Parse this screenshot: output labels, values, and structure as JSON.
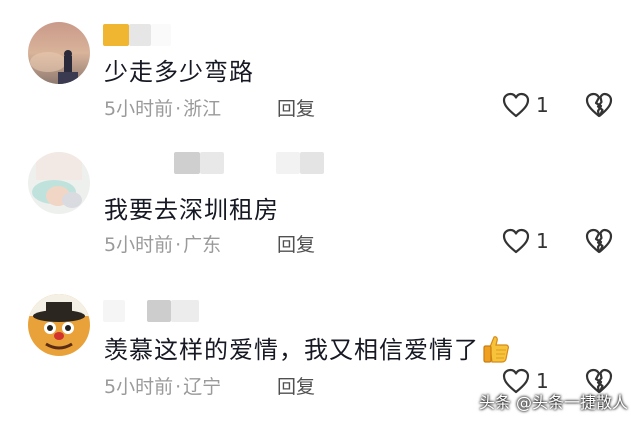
{
  "comments": [
    {
      "text": "少走多少弯路",
      "time": "5小时前",
      "location": "浙江",
      "reply_label": "回复",
      "likes": "1"
    },
    {
      "text": "我要去深圳租房",
      "time": "5小时前",
      "location": "广东",
      "reply_label": "回复",
      "likes": "1"
    },
    {
      "text": "羡慕这样的爱情，我又相信爱情了",
      "time": "5小时前",
      "location": "辽宁",
      "reply_label": "回复",
      "likes": "1"
    }
  ],
  "meta_separator": "·",
  "watermark": "头条 @头条一捷散人",
  "icons": {
    "like": "heart-outline-icon",
    "dislike": "broken-heart-icon",
    "emoji": "thumbs-up-emoji-icon"
  },
  "colors": {
    "text": "#161823",
    "meta": "#9a9a9a",
    "reply": "#505050",
    "icon": "#333333"
  }
}
